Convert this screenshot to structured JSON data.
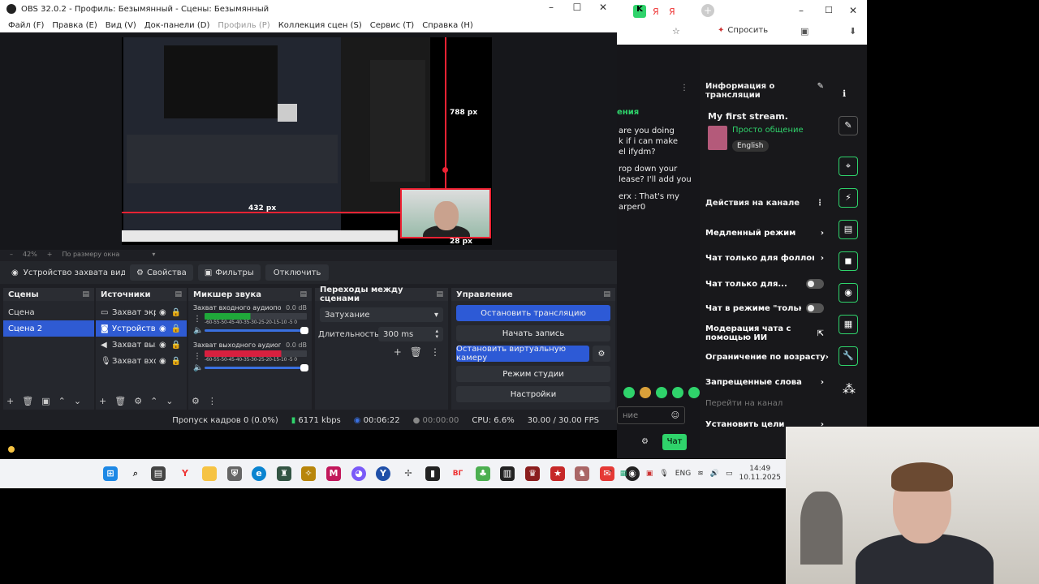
{
  "obs": {
    "title": "OBS 32.0.2 - Профиль: Безымянный - Сцены: Безымянный",
    "menu": [
      {
        "label": "Файл (F)",
        "enabled": true
      },
      {
        "label": "Правка (E)",
        "enabled": true
      },
      {
        "label": "Вид (V)",
        "enabled": true
      },
      {
        "label": "Док-панели (D)",
        "enabled": true
      },
      {
        "label": "Профиль (P)",
        "enabled": false
      },
      {
        "label": "Коллекция сцен (S)",
        "enabled": true
      },
      {
        "label": "Сервис (T)",
        "enabled": true
      },
      {
        "label": "Справка (H)",
        "enabled": true
      }
    ],
    "preview": {
      "height_label": "788 px",
      "width_label": "432 px",
      "bottom_label": "28 px",
      "zoom": "42%",
      "zoom_mode": "По размеру окна"
    },
    "source_toolbar": {
      "source_name": "Устройство захвата видео",
      "properties": "Свойства",
      "filters": "Фильтры",
      "deactivate": "Отключить"
    },
    "scenes": {
      "title": "Сцены",
      "items": [
        "Сцена",
        "Сцена 2"
      ],
      "selected": "Сцена 2"
    },
    "sources": {
      "title": "Источники",
      "items": [
        {
          "label": "Захват экр",
          "icon": "monitor-icon"
        },
        {
          "label": "Устройство",
          "icon": "camera-icon"
        },
        {
          "label": "Захват выхо",
          "icon": "speaker-icon"
        },
        {
          "label": "Захват вхо",
          "icon": "microphone-icon"
        }
      ],
      "selected": "Устройство"
    },
    "mixer": {
      "title": "Микшер звука",
      "tracks": [
        {
          "name": "Захват входного аудиопотока",
          "db": "0.0 dB",
          "color": "#1fa83a",
          "level": 0.45
        },
        {
          "name": "Захват выходного аудиопотока",
          "db": "0.0 dB",
          "color": "#d8203f",
          "level": 0.75
        }
      ],
      "scale": "-60-55-50-45-40-35-30-25-20-15-10 -5  0"
    },
    "transitions": {
      "title": "Переходы между сценами",
      "type": "Затухание",
      "duration_label": "Длительность",
      "duration_value": "300 ms"
    },
    "controls": {
      "title": "Управление",
      "stop_stream": "Остановить трансляцию",
      "start_record": "Начать запись",
      "stop_virtualcam": "Остановить виртуальную камеру",
      "studio_mode": "Режим студии",
      "settings": "Настройки"
    },
    "status": {
      "dropped": "Пропуск кадров 0 (0.0%)",
      "bitrate": "6171 kbps",
      "stream_time": "00:06:22",
      "record_time": "00:00:00",
      "cpu": "CPU: 6.6%",
      "fps": "30.00 / 30.00 FPS"
    }
  },
  "browser": {
    "ask_label": "Спросить"
  },
  "chat": {
    "header": "ения",
    "messages": [
      "are you doing",
      "k if i can make",
      "el ifydm?",
      "rop down your",
      "lease? I'll add you",
      "erx : That's my",
      "arper0"
    ],
    "input_placeholder": "ние",
    "send_button": "Чат"
  },
  "stream_info": {
    "header": "Информация о трансляции",
    "title": "My first stream.",
    "category": "Просто общение",
    "language": "English"
  },
  "channel_actions": {
    "header": "Действия на канале",
    "items": [
      {
        "label": "Медленный режим",
        "control": "arrow"
      },
      {
        "label": "Чат только для фолловеро",
        "control": "arrow"
      },
      {
        "label": "Чат только для...",
        "control": "toggle"
      },
      {
        "label": "Чат в режиме \"только...",
        "control": "toggle"
      },
      {
        "label": "Модерация чата с помощью ИИ",
        "control": "external"
      },
      {
        "label": "Ограничение по возрасту",
        "control": "arrow"
      },
      {
        "label": "Запрещенные слова",
        "control": "arrow"
      },
      {
        "label": "Перейти на канал",
        "control": "none"
      },
      {
        "label": "Установить цели",
        "control": "arrow"
      }
    ]
  },
  "taskbar": {
    "lang": "ENG",
    "time": "14:49",
    "date": "10.11.2025"
  },
  "colors": {
    "obs_bg": "#1e1f24",
    "accent_blue": "#2d5ad6",
    "selection_red": "#e22233",
    "twitch_green": "#2fd36b"
  }
}
